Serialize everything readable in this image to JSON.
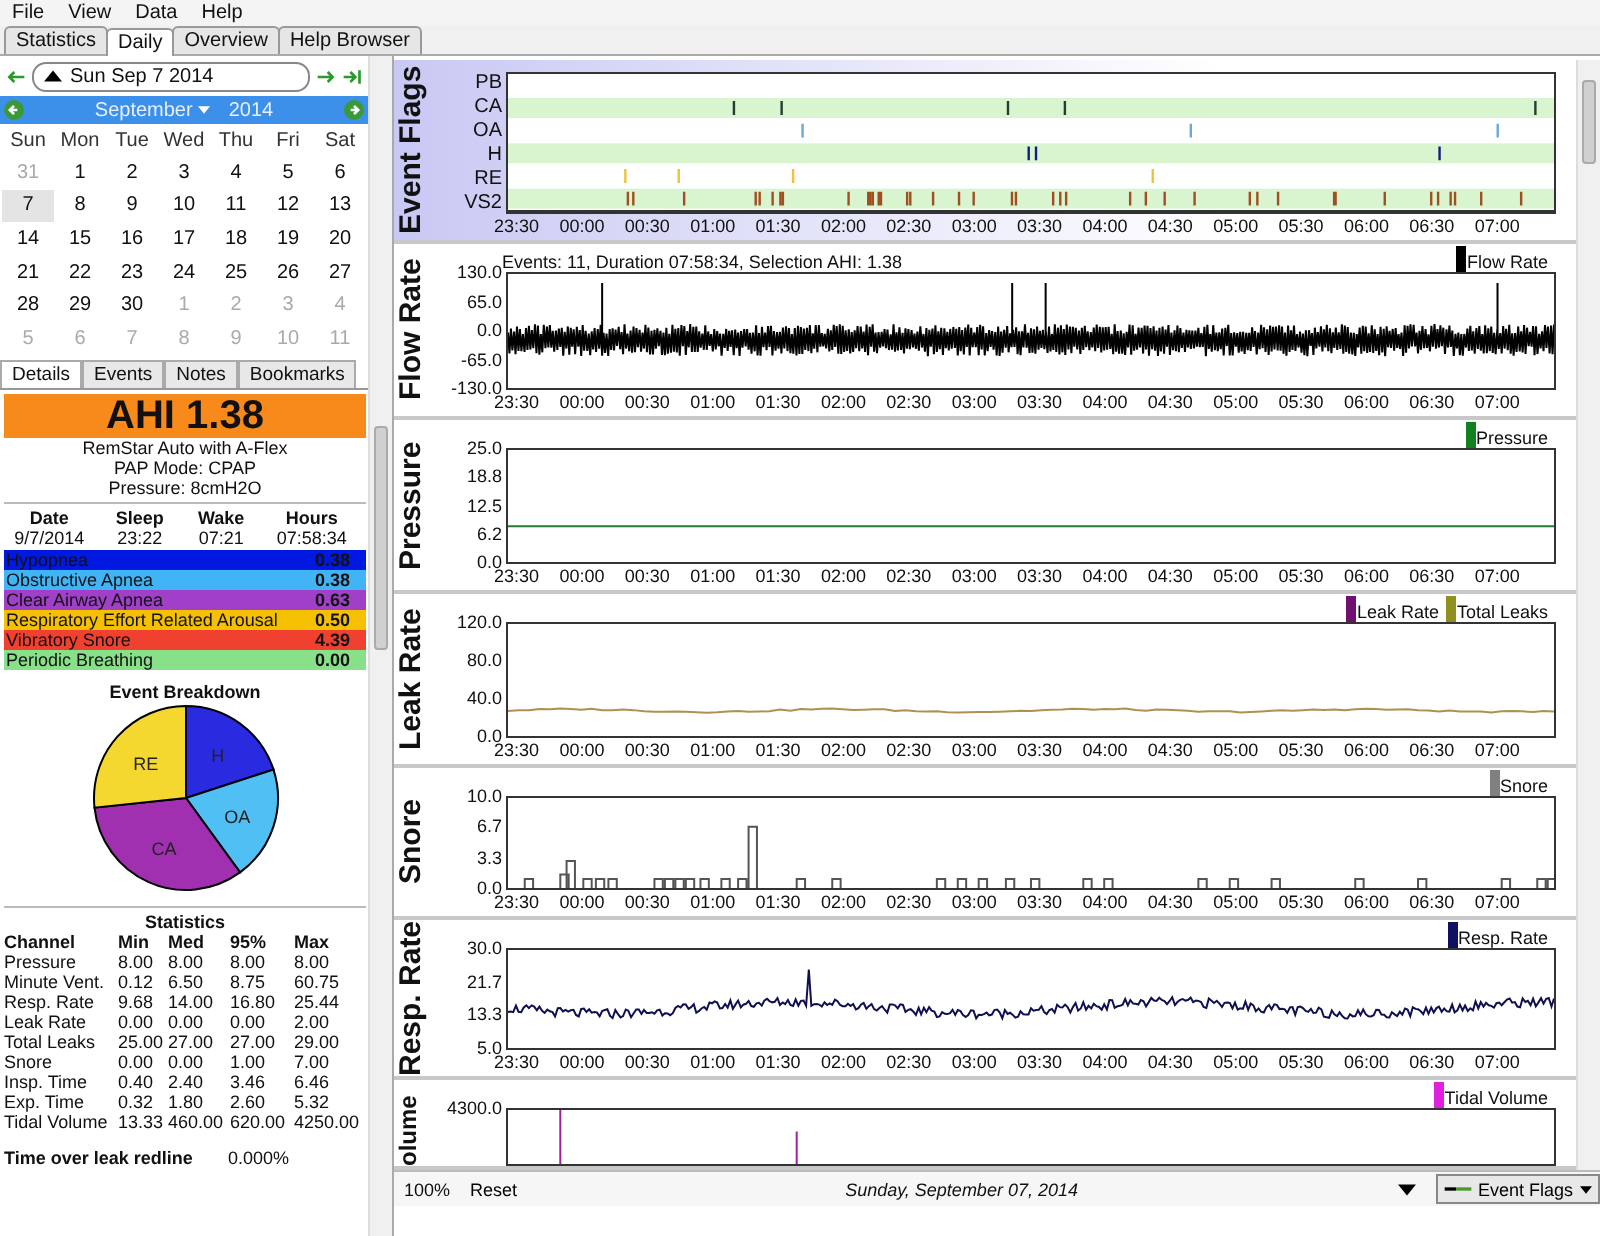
{
  "menu": [
    "File",
    "View",
    "Data",
    "Help"
  ],
  "tabs": [
    {
      "label": "Statistics",
      "selected": false
    },
    {
      "label": "Daily",
      "selected": true
    },
    {
      "label": "Overview",
      "selected": false
    },
    {
      "label": "Help Browser",
      "selected": false
    }
  ],
  "date_nav": {
    "date": "Sun Sep 7 2014"
  },
  "calendar": {
    "month": "September",
    "year": "2014",
    "weekdays": [
      "Sun",
      "Mon",
      "Tue",
      "Wed",
      "Thu",
      "Fri",
      "Sat"
    ],
    "weeks": [
      [
        {
          "day": "31",
          "other_month": true,
          "selected": false
        },
        {
          "day": "1",
          "other_month": false,
          "selected": false
        },
        {
          "day": "2",
          "other_month": false,
          "selected": false
        },
        {
          "day": "3",
          "other_month": false,
          "selected": false
        },
        {
          "day": "4",
          "other_month": false,
          "selected": false
        },
        {
          "day": "5",
          "other_month": false,
          "selected": false
        },
        {
          "day": "6",
          "other_month": false,
          "selected": false
        }
      ],
      [
        {
          "day": "7",
          "other_month": false,
          "selected": true
        },
        {
          "day": "8",
          "other_month": false,
          "selected": false
        },
        {
          "day": "9",
          "other_month": false,
          "selected": false
        },
        {
          "day": "10",
          "other_month": false,
          "selected": false
        },
        {
          "day": "11",
          "other_month": false,
          "selected": false
        },
        {
          "day": "12",
          "other_month": false,
          "selected": false
        },
        {
          "day": "13",
          "other_month": false,
          "selected": false
        }
      ],
      [
        {
          "day": "14",
          "other_month": false,
          "selected": false
        },
        {
          "day": "15",
          "other_month": false,
          "selected": false
        },
        {
          "day": "16",
          "other_month": false,
          "selected": false
        },
        {
          "day": "17",
          "other_month": false,
          "selected": false
        },
        {
          "day": "18",
          "other_month": false,
          "selected": false
        },
        {
          "day": "19",
          "other_month": false,
          "selected": false
        },
        {
          "day": "20",
          "other_month": false,
          "selected": false
        }
      ],
      [
        {
          "day": "21",
          "other_month": false,
          "selected": false
        },
        {
          "day": "22",
          "other_month": false,
          "selected": false
        },
        {
          "day": "23",
          "other_month": false,
          "selected": false
        },
        {
          "day": "24",
          "other_month": false,
          "selected": false
        },
        {
          "day": "25",
          "other_month": false,
          "selected": false
        },
        {
          "day": "26",
          "other_month": false,
          "selected": false
        },
        {
          "day": "27",
          "other_month": false,
          "selected": false
        }
      ],
      [
        {
          "day": "28",
          "other_month": false,
          "selected": false
        },
        {
          "day": "29",
          "other_month": false,
          "selected": false
        },
        {
          "day": "30",
          "other_month": false,
          "selected": false
        },
        {
          "day": "1",
          "other_month": true,
          "selected": false
        },
        {
          "day": "2",
          "other_month": true,
          "selected": false
        },
        {
          "day": "3",
          "other_month": true,
          "selected": false
        },
        {
          "day": "4",
          "other_month": true,
          "selected": false
        }
      ],
      [
        {
          "day": "5",
          "other_month": true,
          "selected": false
        },
        {
          "day": "6",
          "other_month": true,
          "selected": false
        },
        {
          "day": "7",
          "other_month": true,
          "selected": false
        },
        {
          "day": "8",
          "other_month": true,
          "selected": false
        },
        {
          "day": "9",
          "other_month": true,
          "selected": false
        },
        {
          "day": "10",
          "other_month": true,
          "selected": false
        },
        {
          "day": "11",
          "other_month": true,
          "selected": false
        }
      ]
    ]
  },
  "detail_tabs": [
    {
      "label": "Details",
      "selected": true
    },
    {
      "label": "Events",
      "selected": false
    },
    {
      "label": "Notes",
      "selected": false
    },
    {
      "label": "Bookmarks",
      "selected": false
    }
  ],
  "ahi": "AHI 1.38",
  "machine": [
    "RemStar Auto with A-Flex",
    "PAP Mode: CPAP",
    "Pressure: 8cmH2O"
  ],
  "session": {
    "columns": [
      "Date",
      "Sleep",
      "Wake",
      "Hours"
    ],
    "values": [
      "9/7/2014",
      "23:22",
      "07:21",
      "07:58:34"
    ]
  },
  "indices": [
    {
      "label": "Hypopnea",
      "value": "0.38",
      "color": "#0018e0"
    },
    {
      "label": "Obstructive Apnea",
      "value": "0.38",
      "color": "#40b4f4"
    },
    {
      "label": "Clear Airway Apnea",
      "value": "0.63",
      "color": "#a040c8"
    },
    {
      "label": "Respiratory Effort Related Arousal",
      "value": "0.50",
      "color": "#f4c000"
    },
    {
      "label": "Vibratory Snore",
      "value": "4.39",
      "color": "#f04030"
    },
    {
      "label": "Periodic Breathing",
      "value": "0.00",
      "color": "#88e088"
    }
  ],
  "breakdown": {
    "title": "Event Breakdown",
    "slices": [
      {
        "label": "H",
        "color": "#2a2ae0"
      },
      {
        "label": "OA",
        "color": "#50c0f4"
      },
      {
        "label": "CA",
        "color": "#a030b0"
      },
      {
        "label": "RE",
        "color": "#f4d830"
      }
    ]
  },
  "statistics": {
    "title": "Statistics",
    "columns": [
      "Channel",
      "Min",
      "Med",
      "95%",
      "Max"
    ],
    "rows": [
      [
        "Pressure",
        "8.00",
        "8.00",
        "8.00",
        "8.00"
      ],
      [
        "Minute Vent.",
        "0.12",
        "6.50",
        "8.75",
        "60.75"
      ],
      [
        "Resp. Rate",
        "9.68",
        "14.00",
        "16.80",
        "25.44"
      ],
      [
        "Leak Rate",
        "0.00",
        "0.00",
        "0.00",
        "2.00"
      ],
      [
        "Total Leaks",
        "25.00",
        "27.00",
        "27.00",
        "29.00"
      ],
      [
        "Snore",
        "0.00",
        "0.00",
        "1.00",
        "7.00"
      ],
      [
        "Insp. Time",
        "0.40",
        "2.40",
        "3.46",
        "6.46"
      ],
      [
        "Exp. Time",
        "0.32",
        "1.80",
        "2.60",
        "5.32"
      ],
      [
        "Tidal Volume",
        "13.33",
        "460.00",
        "620.00",
        "4250.00"
      ]
    ]
  },
  "leak_redline": {
    "label": "Time over leak redline",
    "value": "0.000%"
  },
  "graphs": [
    {
      "kind": "flags",
      "title": "Event Flags",
      "rows": [
        "PB",
        "CA",
        "OA",
        "H",
        "RE",
        "VS2"
      ],
      "x_ticks": [
        "23:30",
        "00:00",
        "00:30",
        "01:00",
        "01:30",
        "02:00",
        "02:30",
        "03:00",
        "03:30",
        "04:00",
        "04:30",
        "05:00",
        "05:30",
        "06:00",
        "06:30",
        "07:00"
      ]
    },
    {
      "kind": "wave",
      "title": "Flow Rate",
      "info": "Events: 11, Duration 07:58:34, Selection AHI: 1.38",
      "legend": [
        {
          "label": "Flow Rate",
          "color": "#000000"
        }
      ],
      "y_ticks": [
        "130.0",
        "65.0",
        "0.0",
        "-65.0",
        "-130.0"
      ],
      "x_ticks": [
        "23:30",
        "00:00",
        "00:30",
        "01:00",
        "01:30",
        "02:00",
        "02:30",
        "03:00",
        "03:30",
        "04:00",
        "04:30",
        "05:00",
        "05:30",
        "06:00",
        "06:30",
        "07:00"
      ]
    },
    {
      "kind": "flat",
      "title": "Pressure",
      "legend": [
        {
          "label": "Pressure",
          "color": "#108020"
        }
      ],
      "y_ticks": [
        "25.0",
        "18.8",
        "12.5",
        "6.2",
        "0.0"
      ],
      "x_ticks": [
        "23:30",
        "00:00",
        "00:30",
        "01:00",
        "01:30",
        "02:00",
        "02:30",
        "03:00",
        "03:30",
        "04:00",
        "04:30",
        "05:00",
        "05:30",
        "06:00",
        "06:30",
        "07:00"
      ]
    },
    {
      "kind": "line",
      "title": "Leak Rate",
      "legend": [
        {
          "label": "Leak Rate",
          "color": "#701070"
        },
        {
          "label": "Total Leaks",
          "color": "#909020"
        }
      ],
      "y_ticks": [
        "120.0",
        "80.0",
        "40.0",
        "0.0"
      ],
      "x_ticks": [
        "23:30",
        "00:00",
        "00:30",
        "01:00",
        "01:30",
        "02:00",
        "02:30",
        "03:00",
        "03:30",
        "04:00",
        "04:30",
        "05:00",
        "05:30",
        "06:00",
        "06:30",
        "07:00"
      ]
    },
    {
      "kind": "bars",
      "title": "Snore",
      "legend": [
        {
          "label": "Snore",
          "color": "#808080"
        }
      ],
      "y_ticks": [
        "10.0",
        "6.7",
        "3.3",
        "0.0"
      ],
      "x_ticks": [
        "23:30",
        "00:00",
        "00:30",
        "01:00",
        "01:30",
        "02:00",
        "02:30",
        "03:00",
        "03:30",
        "04:00",
        "04:30",
        "05:00",
        "05:30",
        "06:00",
        "06:30",
        "07:00"
      ]
    },
    {
      "kind": "resp",
      "title": "Resp. Rate",
      "legend": [
        {
          "label": "Resp. Rate",
          "color": "#101060"
        }
      ],
      "y_ticks": [
        "30.0",
        "21.7",
        "13.3",
        "5.0"
      ],
      "x_ticks": [
        "23:30",
        "00:00",
        "00:30",
        "01:00",
        "01:30",
        "02:00",
        "02:30",
        "03:00",
        "03:30",
        "04:00",
        "04:30",
        "05:00",
        "05:30",
        "06:00",
        "06:30",
        "07:00"
      ]
    },
    {
      "kind": "cut",
      "title": "olume",
      "legend": [
        {
          "label": "Tidal Volume",
          "color": "#e020e0"
        }
      ],
      "y_ticks": [
        "4300.0"
      ]
    }
  ],
  "status_bar": {
    "zoom": "100%",
    "reset": "Reset",
    "date": "Sunday, September 07, 2014",
    "layout_button": "Event Flags"
  }
}
